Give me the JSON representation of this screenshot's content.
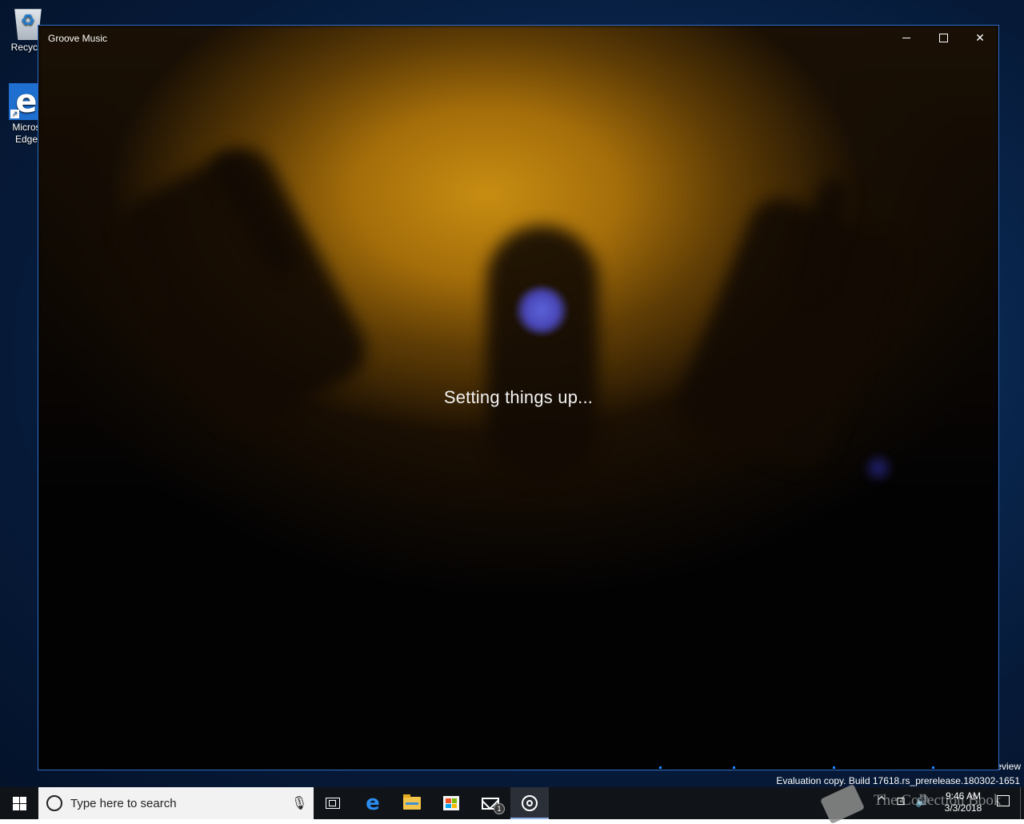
{
  "desktop": {
    "icons": [
      {
        "label": "Recycle",
        "icon": "recycle-bin-icon"
      },
      {
        "label": "Micros\nEdge",
        "icon": "edge-icon"
      }
    ],
    "watermark": {
      "preview_tail": "eview",
      "evaluation": "Evaluation copy. Build 17618.rs_prerelease.180302-1651"
    }
  },
  "window": {
    "title": "Groove Music",
    "status_text": "Setting things up...",
    "caption_buttons": {
      "minimize": "minimize-icon",
      "maximize": "maximize-icon",
      "close": "✕"
    },
    "accent_color": "#2f6cc6"
  },
  "taskbar": {
    "search_placeholder": "Type here to search",
    "pinned": [
      {
        "name": "task-view",
        "icon": "task-view-icon"
      },
      {
        "name": "edge",
        "icon": "edge-icon",
        "glyph": "e"
      },
      {
        "name": "file-explorer",
        "icon": "folder-icon"
      },
      {
        "name": "store",
        "icon": "store-icon"
      },
      {
        "name": "mail",
        "icon": "mail-icon",
        "badge": "1"
      },
      {
        "name": "groove-music",
        "icon": "groove-icon",
        "active": true
      }
    ],
    "tray": {
      "watermark": "The Collection Book",
      "time": "9:46 AM",
      "date": "3/3/2018"
    }
  }
}
